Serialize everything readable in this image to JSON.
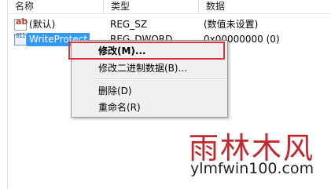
{
  "columns": [
    "名称",
    "类型",
    "数据"
  ],
  "rows": [
    {
      "icon": "string-value-icon",
      "icon_glyph": "ab",
      "name": "(默认)",
      "type": "REG_SZ",
      "data": "(数值未设置)"
    },
    {
      "icon": "binary-value-icon",
      "icon_glyph": "011",
      "name": "WriteProtect",
      "type": "REG_DWORD",
      "data": "0x00000000 (0)"
    }
  ],
  "context_menu": {
    "items": [
      {
        "label": "修改(M)...",
        "bold": true
      },
      {
        "label": "修改二进制数据(B)..."
      },
      {
        "label": "删除(D)"
      },
      {
        "label": "重命名(R)"
      }
    ]
  },
  "highlight_color": "#e0323a",
  "watermark": {
    "cn": "雨林木风",
    "url": "ylmfwin100.com"
  }
}
